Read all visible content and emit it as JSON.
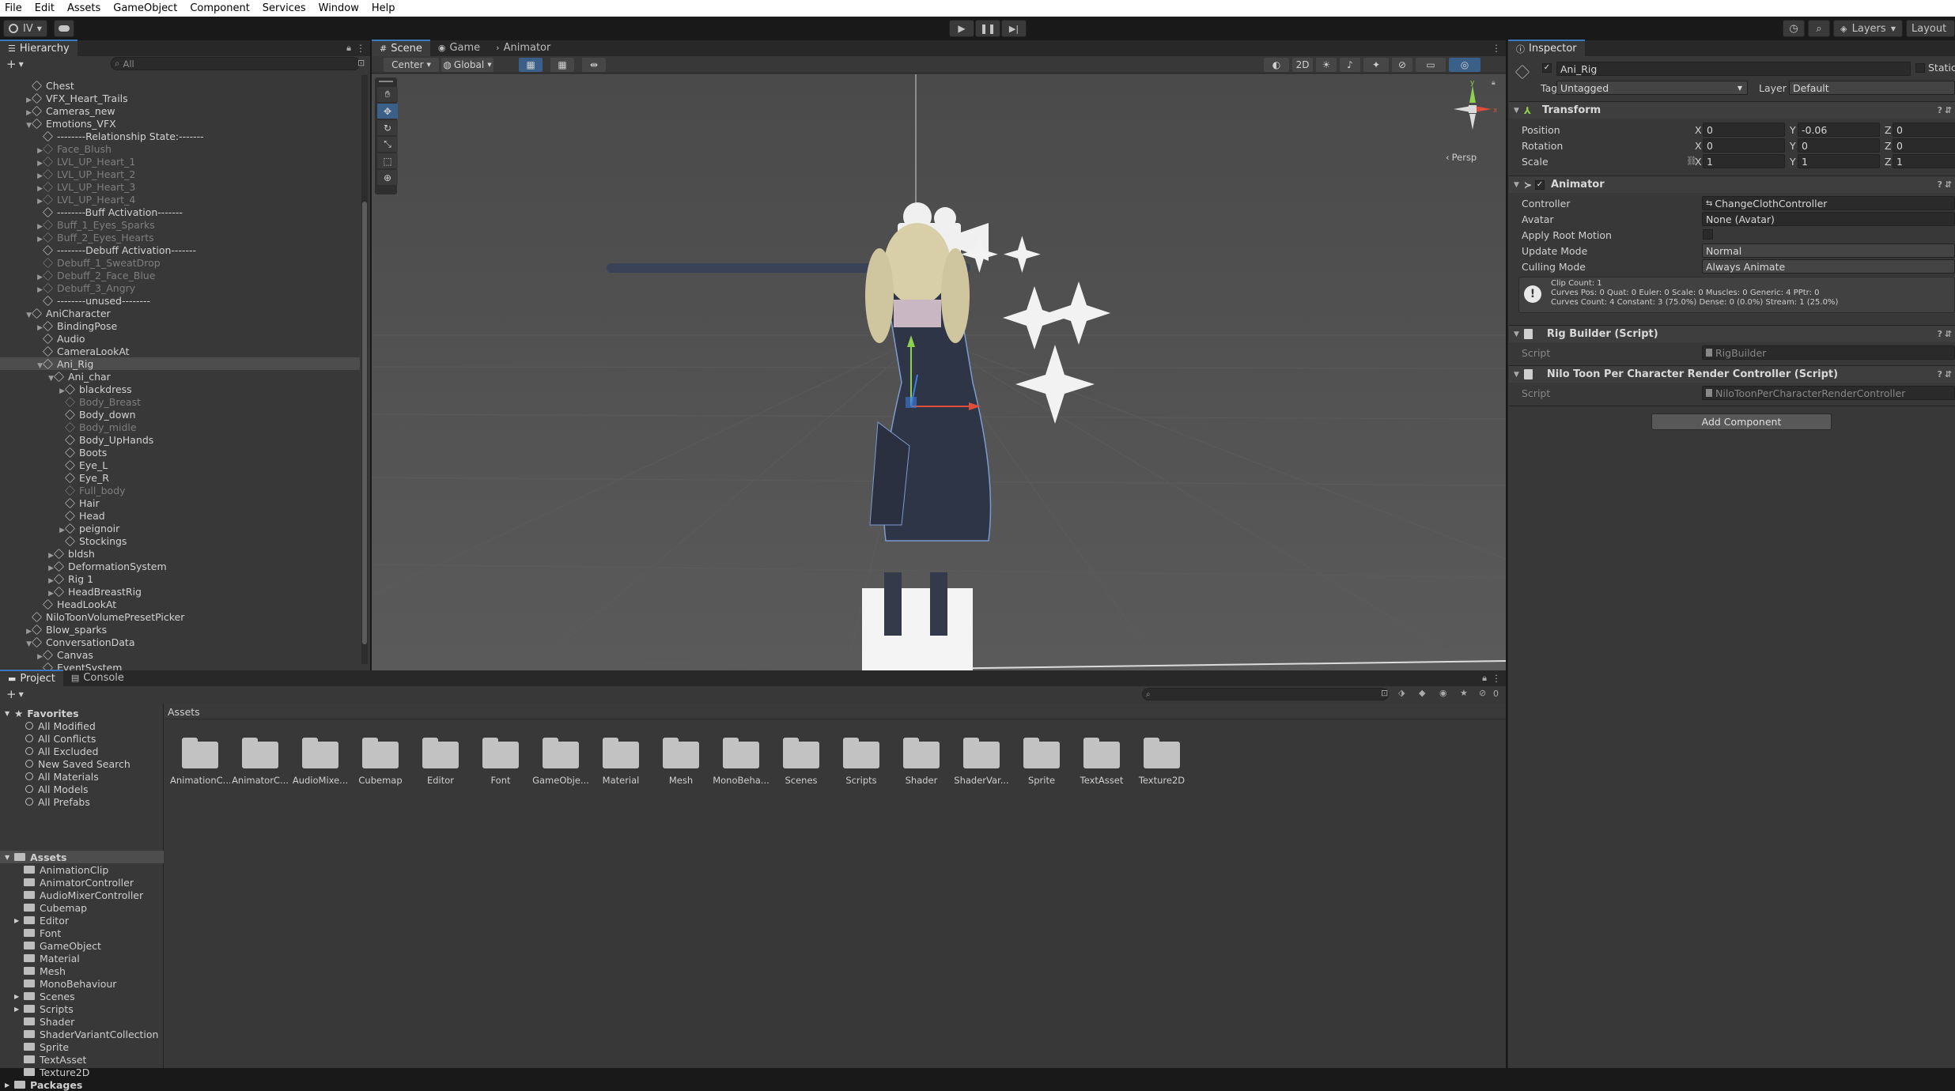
{
  "menu": [
    "File",
    "Edit",
    "Assets",
    "GameObject",
    "Component",
    "Services",
    "Window",
    "Help"
  ],
  "toolbar": {
    "account": "IV",
    "layers": "Layers",
    "layout": "Layout"
  },
  "hierarchy": {
    "tab": "Hierarchy",
    "search_placeholder": "All",
    "rows": [
      {
        "label": "Chest",
        "depth": 1,
        "arrow": "",
        "dim": false
      },
      {
        "label": "VFX_Heart_Trails",
        "depth": 1,
        "arrow": "▶",
        "dim": false
      },
      {
        "label": "Cameras_new",
        "depth": 1,
        "arrow": "▶",
        "dim": false
      },
      {
        "label": "Emotions_VFX",
        "depth": 1,
        "arrow": "▼",
        "dim": false
      },
      {
        "label": "--------Relationship State:-------",
        "depth": 2,
        "arrow": "",
        "dim": false
      },
      {
        "label": "Face_Blush",
        "depth": 2,
        "arrow": "▶",
        "dim": true
      },
      {
        "label": "LVL_UP_Heart_1",
        "depth": 2,
        "arrow": "▶",
        "dim": true
      },
      {
        "label": "LVL_UP_Heart_2",
        "depth": 2,
        "arrow": "▶",
        "dim": true
      },
      {
        "label": "LVL_UP_Heart_3",
        "depth": 2,
        "arrow": "▶",
        "dim": true
      },
      {
        "label": "LVL_UP_Heart_4",
        "depth": 2,
        "arrow": "▶",
        "dim": true
      },
      {
        "label": "--------Buff Activation-------",
        "depth": 2,
        "arrow": "",
        "dim": false
      },
      {
        "label": "Buff_1_Eyes_Sparks",
        "depth": 2,
        "arrow": "▶",
        "dim": true
      },
      {
        "label": "Buff_2_Eyes_Hearts",
        "depth": 2,
        "arrow": "▶",
        "dim": true
      },
      {
        "label": "--------Debuff Activation-------",
        "depth": 2,
        "arrow": "",
        "dim": false
      },
      {
        "label": "Debuff_1_SweatDrop",
        "depth": 2,
        "arrow": "",
        "dim": true
      },
      {
        "label": "Debuff_2_Face_Blue",
        "depth": 2,
        "arrow": "▶",
        "dim": true
      },
      {
        "label": "Debuff_3_Angry",
        "depth": 2,
        "arrow": "▶",
        "dim": true
      },
      {
        "label": "--------unused--------",
        "depth": 2,
        "arrow": "",
        "dim": false
      },
      {
        "label": "AniCharacter",
        "depth": 1,
        "arrow": "▼",
        "dim": false
      },
      {
        "label": "BindingPose",
        "depth": 2,
        "arrow": "▶",
        "dim": false
      },
      {
        "label": "Audio",
        "depth": 2,
        "arrow": "",
        "dim": false
      },
      {
        "label": "CameraLookAt",
        "depth": 2,
        "arrow": "",
        "dim": false
      },
      {
        "label": "Ani_Rig",
        "depth": 2,
        "arrow": "▼",
        "dim": false,
        "selected": true
      },
      {
        "label": "Ani_char",
        "depth": 3,
        "arrow": "▼",
        "dim": false
      },
      {
        "label": "blackdress",
        "depth": 4,
        "arrow": "▶",
        "dim": false
      },
      {
        "label": "Body_Breast",
        "depth": 4,
        "arrow": "",
        "dim": true
      },
      {
        "label": "Body_down",
        "depth": 4,
        "arrow": "",
        "dim": false
      },
      {
        "label": "Body_midle",
        "depth": 4,
        "arrow": "",
        "dim": true
      },
      {
        "label": "Body_UpHands",
        "depth": 4,
        "arrow": "",
        "dim": false
      },
      {
        "label": "Boots",
        "depth": 4,
        "arrow": "",
        "dim": false
      },
      {
        "label": "Eye_L",
        "depth": 4,
        "arrow": "",
        "dim": false
      },
      {
        "label": "Eye_R",
        "depth": 4,
        "arrow": "",
        "dim": false
      },
      {
        "label": "Full_body",
        "depth": 4,
        "arrow": "",
        "dim": true
      },
      {
        "label": "Hair",
        "depth": 4,
        "arrow": "",
        "dim": false
      },
      {
        "label": "Head",
        "depth": 4,
        "arrow": "",
        "dim": false
      },
      {
        "label": "peignoir",
        "depth": 4,
        "arrow": "▶",
        "dim": false
      },
      {
        "label": "Stockings",
        "depth": 4,
        "arrow": "",
        "dim": false
      },
      {
        "label": "bldsh",
        "depth": 3,
        "arrow": "▶",
        "dim": false
      },
      {
        "label": "DeformationSystem",
        "depth": 3,
        "arrow": "▶",
        "dim": false
      },
      {
        "label": "Rig 1",
        "depth": 3,
        "arrow": "▶",
        "dim": false
      },
      {
        "label": "HeadBreastRig",
        "depth": 3,
        "arrow": "▶",
        "dim": false
      },
      {
        "label": "HeadLookAt",
        "depth": 2,
        "arrow": "",
        "dim": false
      },
      {
        "label": "NiloToonVolumePresetPicker",
        "depth": 1,
        "arrow": "",
        "dim": false
      },
      {
        "label": "Blow_sparks",
        "depth": 1,
        "arrow": "▶",
        "dim": false
      },
      {
        "label": "ConversationData",
        "depth": 1,
        "arrow": "▼",
        "dim": false
      },
      {
        "label": "Canvas",
        "depth": 2,
        "arrow": "▶",
        "dim": false
      },
      {
        "label": "EventSystem",
        "depth": 2,
        "arrow": "",
        "dim": false
      }
    ]
  },
  "scene": {
    "tabs": [
      "Scene",
      "Game",
      "Animator"
    ],
    "pivot": "Center",
    "space": "Global",
    "mode_2d": "2D",
    "persp": "Persp"
  },
  "inspector": {
    "tab": "Inspector",
    "object_name": "Ani_Rig",
    "static_label": "Static",
    "tag_label": "Tag",
    "tag_value": "Untagged",
    "layer_label": "Layer",
    "layer_value": "Default",
    "transform": {
      "title": "Transform",
      "position_label": "Position",
      "position": [
        "0",
        "-0.06",
        "0"
      ],
      "rotation_label": "Rotation",
      "rotation": [
        "0",
        "0",
        "0"
      ],
      "scale_label": "Scale",
      "scale": [
        "1",
        "1",
        "1"
      ]
    },
    "animator": {
      "title": "Animator",
      "controller_label": "Controller",
      "controller": "ChangeClothController",
      "avatar_label": "Avatar",
      "avatar": "None (Avatar)",
      "apply_root_label": "Apply Root Motion",
      "update_label": "Update Mode",
      "update": "Normal",
      "culling_label": "Culling Mode",
      "culling": "Always Animate",
      "info1": "Clip Count: 1",
      "info2": "Curves Pos: 0 Quat: 0 Euler: 0 Scale: 0 Muscles: 0 Generic: 4 PPtr: 0",
      "info3": "Curves Count: 4 Constant: 3 (75.0%) Dense: 0 (0.0%) Stream: 1 (25.0%)"
    },
    "rig_builder": {
      "title": "Rig Builder (Script)",
      "script_label": "Script",
      "script": "RigBuilder"
    },
    "nilo": {
      "title": "Nilo Toon Per Character Render Controller (Script)",
      "script_label": "Script",
      "script": "NiloToonPerCharacterRenderController"
    },
    "add_component": "Add Component"
  },
  "project": {
    "tabs": [
      "Project",
      "Console"
    ],
    "favorites_title": "Favorites",
    "favorites": [
      "All Modified",
      "All Conflicts",
      "All Excluded",
      "New Saved Search",
      "All Materials",
      "All Models",
      "All Prefabs"
    ],
    "assets_title": "Assets",
    "asset_tree": [
      "AnimationClip",
      "AnimatorController",
      "AudioMixerController",
      "Cubemap",
      "Editor",
      "Font",
      "GameObject",
      "Material",
      "Mesh",
      "MonoBehaviour",
      "Scenes",
      "Scripts",
      "Shader",
      "ShaderVariantCollection",
      "Sprite",
      "TextAsset",
      "Texture2D"
    ],
    "packages_title": "Packages",
    "breadcrumb": "Assets",
    "hidden_count": "0",
    "folders": [
      "AnimationC...",
      "AnimatorC...",
      "AudioMixe...",
      "Cubemap",
      "Editor",
      "Font",
      "GameObje...",
      "Material",
      "Mesh",
      "MonoBeha...",
      "Scenes",
      "Scripts",
      "Shader",
      "ShaderVar...",
      "Sprite",
      "TextAsset",
      "Texture2D"
    ]
  }
}
